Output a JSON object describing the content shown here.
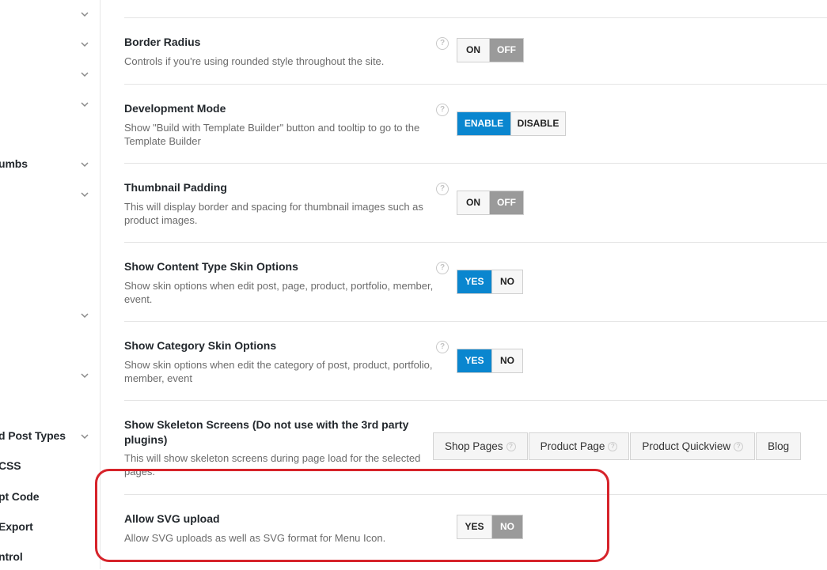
{
  "sidebar": {
    "items": [
      {
        "label": "",
        "icon": "chevron-down-icon"
      },
      {
        "label": "",
        "icon": "chevron-down-icon"
      },
      {
        "label": "",
        "icon": "chevron-down-icon"
      },
      {
        "label": "",
        "icon": "chevron-down-icon"
      },
      {
        "label": "umbs",
        "icon": "chevron-down-icon"
      },
      {
        "label": "",
        "icon": "chevron-down-icon"
      },
      {
        "label": "",
        "icon": "chevron-down-icon"
      },
      {
        "label": "",
        "icon": "chevron-down-icon"
      },
      {
        "label": "d Post Types",
        "icon": "chevron-down-icon"
      },
      {
        "label": "CSS"
      },
      {
        "label": "pt Code"
      },
      {
        "label": " Export"
      },
      {
        "label": "ntrol"
      }
    ],
    "stray_mark": "‘"
  },
  "settings": [
    {
      "title": "Border Radius",
      "description": "Controls if you're using rounded style throughout the site.",
      "options": [
        "ON",
        "OFF"
      ],
      "selected": "OFF"
    },
    {
      "title": "Development Mode",
      "description": "Show \"Build with Template Builder\" button and tooltip to go to the Template Builder",
      "options": [
        "ENABLE",
        "DISABLE"
      ],
      "selected": "ENABLE"
    },
    {
      "title": "Thumbnail Padding",
      "description": "This will display border and spacing for thumbnail images such as product images.",
      "options": [
        "ON",
        "OFF"
      ],
      "selected": "OFF"
    },
    {
      "title": "Show Content Type Skin Options",
      "description": "Show skin options when edit post, page, product, portfolio, member, event.",
      "options": [
        "YES",
        "NO"
      ],
      "selected": "YES"
    },
    {
      "title": "Show Category Skin Options",
      "description": "Show skin options when edit the category of post, product, portfolio, member, event",
      "options": [
        "YES",
        "NO"
      ],
      "selected": "YES"
    },
    {
      "title": "Show Skeleton Screens (Do not use with the 3rd party plugins)",
      "description": "This will show skeleton screens during page load for the selected pages.",
      "pages": [
        "Shop Pages",
        "Product Page",
        "Product Quickview",
        "Blog"
      ]
    },
    {
      "title": "Allow SVG upload",
      "description": "Allow SVG uploads as well as SVG format for Menu Icon.",
      "options": [
        "YES",
        "NO"
      ],
      "selected": "NO"
    }
  ],
  "help_glyph": "?",
  "colors": {
    "active_blue": "#0a86cf",
    "active_gray": "#9a9a9a",
    "highlight_red": "#d6232a"
  }
}
